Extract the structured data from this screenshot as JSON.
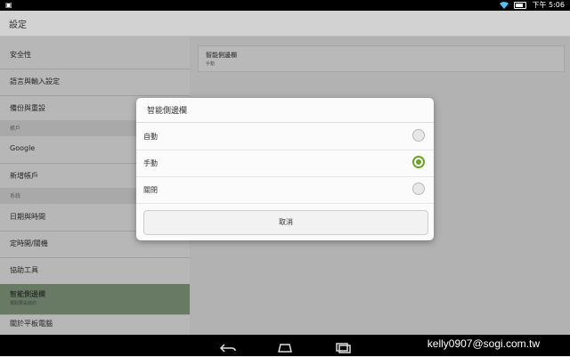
{
  "status_bar": {
    "carrier_icon": "screenshot-icon",
    "time": "下午 5:06"
  },
  "app_bar": {
    "title": "設定"
  },
  "left_menu": {
    "items": [
      {
        "label": "安全性"
      },
      {
        "label": "語言與輸入設定"
      },
      {
        "label": "備份與重設"
      }
    ],
    "section_accounts": "帳戶",
    "accounts": [
      {
        "label": "Google"
      },
      {
        "label": "新增帳戶"
      }
    ],
    "section_system": "系統",
    "system": [
      {
        "label": "日期與時間"
      },
      {
        "label": "定時開/關機"
      },
      {
        "label": "協助工具"
      },
      {
        "label": "智能側邊欄",
        "sub": "選取要是啟的",
        "selected": true
      },
      {
        "label": "關於平板電腦"
      }
    ]
  },
  "detail": {
    "title": "智能側邊欄",
    "summary": "手動"
  },
  "dialog": {
    "title": "智能側邊欄",
    "options": [
      {
        "label": "自動",
        "checked": false
      },
      {
        "label": "手動",
        "checked": true
      },
      {
        "label": "關閉",
        "checked": false
      }
    ],
    "cancel_label": "取消"
  },
  "nav_bar": {
    "icons": [
      "back-icon",
      "home-icon",
      "recents-icon"
    ],
    "watermark": "kelly0907@sogi.com.tw"
  },
  "colors": {
    "accent": "#6aa329",
    "selected_row": "#8ba385"
  }
}
